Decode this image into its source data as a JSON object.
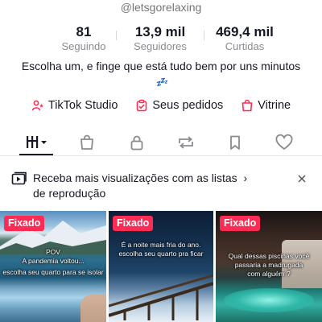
{
  "profile": {
    "username": "@letsgorelaxing",
    "stats": [
      {
        "value": "81",
        "label": "Seguindo"
      },
      {
        "value": "13,9 mil",
        "label": "Seguidores"
      },
      {
        "value": "469,4 mil",
        "label": "Curtidas"
      }
    ],
    "bio": "Escolha um, e finge que está tudo bem por uns minutos",
    "bio_emoji": "💤"
  },
  "links": [
    {
      "label": "TikTok Studio",
      "icon": "studio-icon"
    },
    {
      "label": "Seus pedidos",
      "icon": "orders-icon"
    },
    {
      "label": "Vitrine",
      "icon": "shop-icon"
    }
  ],
  "tabs": [
    {
      "icon": "videos-grid-icon",
      "active": true
    },
    {
      "icon": "shopping-bag-icon"
    },
    {
      "icon": "lock-icon"
    },
    {
      "icon": "repost-icon"
    },
    {
      "icon": "bookmark-icon"
    },
    {
      "icon": "heart-icon"
    }
  ],
  "banner": {
    "text_line1": "Receba mais visualizações com as listas",
    "arrow": "›",
    "text_line2": "de reprodução"
  },
  "videos": [
    {
      "badge": "Fixado",
      "caption_1": "POV",
      "caption_2": "A pandemia voltou...",
      "caption_3": "escolha seu quarto para se isolar"
    },
    {
      "badge": "Fixado",
      "caption_1": "É a noite mais fria do ano.",
      "caption_2": "escolha seu quarto pra ficar"
    },
    {
      "badge": "Fixado",
      "caption_1": "Qual dessas piscinas você",
      "caption_2": "passaria a madrugada",
      "caption_3": "com alguém ?"
    }
  ],
  "colors": {
    "accent": "#fe2c55",
    "text": "#161823",
    "muted": "#8a8b91"
  }
}
